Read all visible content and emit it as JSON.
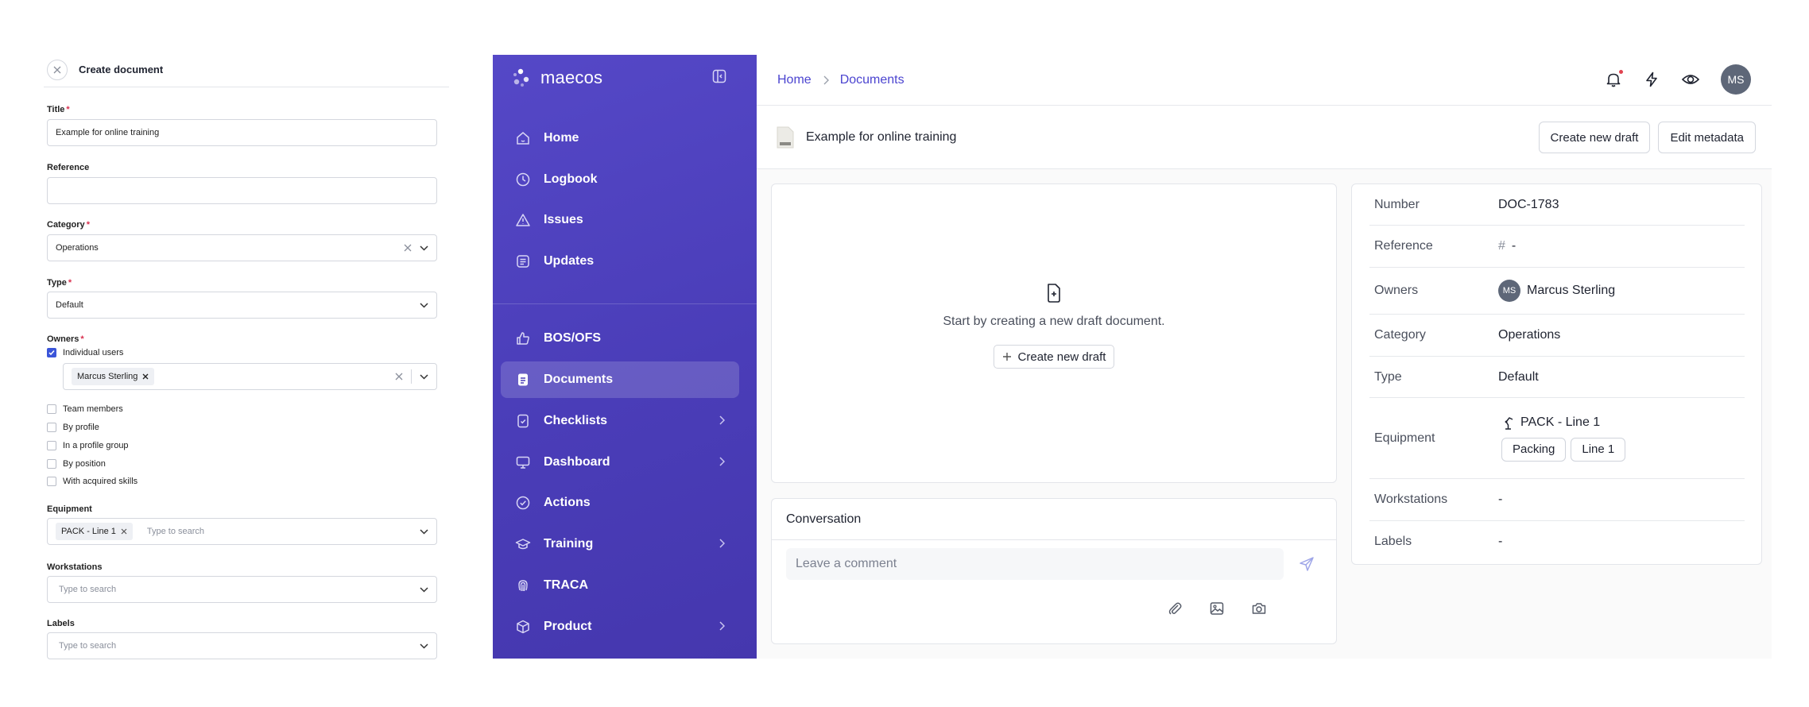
{
  "form": {
    "title": "Create document",
    "fields": {
      "title_label": "Title",
      "title_value": "Example for online training",
      "reference_label": "Reference",
      "reference_value": "",
      "category_label": "Category",
      "category_value": "Operations",
      "type_label": "Type",
      "type_value": "Default",
      "owners_label": "Owners",
      "equipment_label": "Equipment",
      "equipment_chip": "PACK - Line 1",
      "equipment_placeholder": "Type to search",
      "workstations_label": "Workstations",
      "workstations_placeholder": "Type to search",
      "labels_label": "Labels",
      "labels_placeholder": "Type to search"
    },
    "owner_options": [
      {
        "label": "Individual users",
        "checked": true
      },
      {
        "label": "Team members",
        "checked": false
      },
      {
        "label": "By profile",
        "checked": false
      },
      {
        "label": "In a profile group",
        "checked": false
      },
      {
        "label": "By position",
        "checked": false
      },
      {
        "label": "With acquired skills",
        "checked": false
      }
    ],
    "owner_chip": "Marcus Sterling",
    "required_mark": "*"
  },
  "app": {
    "brand": "maecos",
    "nav": [
      {
        "label": "Home",
        "icon": "home-icon",
        "active": false,
        "chevron": false
      },
      {
        "label": "Logbook",
        "icon": "clock-icon",
        "active": false,
        "chevron": false
      },
      {
        "label": "Issues",
        "icon": "warning-icon",
        "active": false,
        "chevron": false
      },
      {
        "label": "Updates",
        "icon": "news-icon",
        "active": false,
        "chevron": false
      },
      {
        "label": "BOS/OFS",
        "icon": "thumbs-up-icon",
        "active": false,
        "chevron": false
      },
      {
        "label": "Documents",
        "icon": "document-icon",
        "active": true,
        "chevron": false
      },
      {
        "label": "Checklists",
        "icon": "checklist-icon",
        "active": false,
        "chevron": true
      },
      {
        "label": "Dashboard",
        "icon": "monitor-icon",
        "active": false,
        "chevron": true
      },
      {
        "label": "Actions",
        "icon": "check-circle-icon",
        "active": false,
        "chevron": false
      },
      {
        "label": "Training",
        "icon": "graduation-cap-icon",
        "active": false,
        "chevron": true
      },
      {
        "label": "TRACA",
        "icon": "fingerprint-icon",
        "active": false,
        "chevron": false
      },
      {
        "label": "Product",
        "icon": "box-icon",
        "active": false,
        "chevron": true
      }
    ],
    "breadcrumb": [
      "Home",
      "Documents"
    ],
    "user_initials": "MS",
    "document": {
      "title": "Example for online training",
      "create_draft_label": "Create new draft",
      "edit_metadata_label": "Edit metadata",
      "empty_text": "Start by creating a new draft document.",
      "empty_button": "Create new draft"
    },
    "conversation": {
      "title": "Conversation",
      "placeholder": "Leave a comment"
    },
    "metadata": {
      "number_key": "Number",
      "number_val": "DOC-1783",
      "reference_key": "Reference",
      "reference_hash": "#",
      "reference_val": "-",
      "owners_key": "Owners",
      "owner_initials": "MS",
      "owner_name": "Marcus Sterling",
      "category_key": "Category",
      "category_val": "Operations",
      "type_key": "Type",
      "type_val": "Default",
      "equipment_key": "Equipment",
      "equipment_val": "PACK - Line 1",
      "equipment_tags": [
        "Packing",
        "Line 1"
      ],
      "workstations_key": "Workstations",
      "workstations_val": "-",
      "labels_key": "Labels",
      "labels_val": "-"
    }
  },
  "colors": {
    "brand_primary": "#4b44d0",
    "sidebar_bg": "#4a3db8",
    "danger": "#e0424f"
  }
}
